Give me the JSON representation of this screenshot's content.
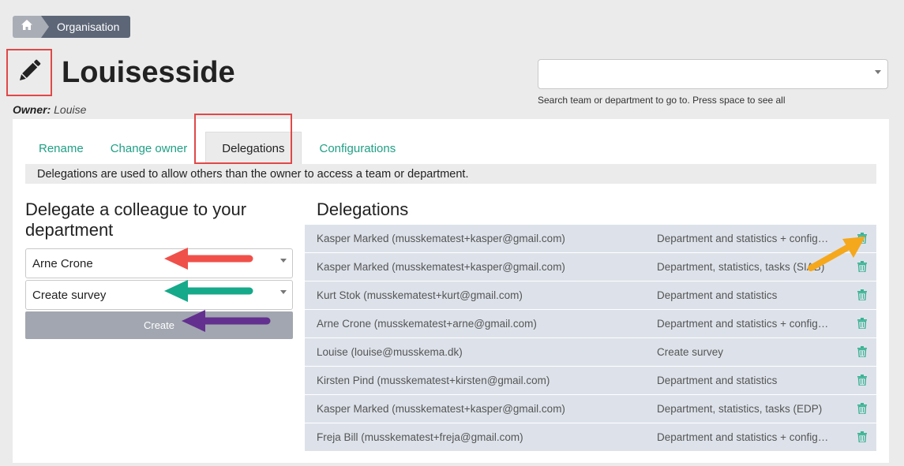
{
  "breadcrumb": {
    "home_icon": "home-icon",
    "current": "Organisation"
  },
  "page": {
    "title": "Louisesside",
    "owner_label": "Owner:",
    "owner_name": "Louise",
    "edit_icon": "pencil-icon"
  },
  "search": {
    "value": "",
    "hint": "Search team or department to go to. Press space to see all"
  },
  "tabs": [
    {
      "label": "Rename"
    },
    {
      "label": "Change owner"
    },
    {
      "label": "Delegations"
    },
    {
      "label": "Configurations"
    }
  ],
  "info": "Delegations are used to allow others than the owner to access a team or department.",
  "delegate_form": {
    "heading": "Delegate a colleague to your department",
    "colleague_value": "Arne Crone",
    "permission_value": "Create survey",
    "create_label": "Create"
  },
  "delegations": {
    "heading": "Delegations",
    "rows": [
      {
        "who": "Kasper Marked (musskematest+kasper@gmail.com)",
        "what": "Department and statistics + configurations"
      },
      {
        "who": "Kasper Marked (musskematest+kasper@gmail.com)",
        "what": "Department, statistics, tasks (SIAB)"
      },
      {
        "who": "Kurt Stok (musskematest+kurt@gmail.com)",
        "what": "Department and statistics"
      },
      {
        "who": "Arne Crone (musskematest+arne@gmail.com)",
        "what": "Department and statistics + configurations"
      },
      {
        "who": "Louise (louise@musskema.dk)",
        "what": "Create survey"
      },
      {
        "who": "Kirsten Pind (musskematest+kirsten@gmail.com)",
        "what": "Department and statistics"
      },
      {
        "who": "Kasper Marked (musskematest+kasper@gmail.com)",
        "what": "Department, statistics, tasks (EDP)"
      },
      {
        "who": "Freja Bill (musskematest+freja@gmail.com)",
        "what": "Department and statistics + configurations"
      }
    ]
  },
  "colors": {
    "accent": "#20a085",
    "highlight_box": "#e04848",
    "arrow_red": "#f0504a",
    "arrow_green": "#16a98a",
    "arrow_purple": "#63308f",
    "arrow_orange": "#f5a81c"
  }
}
